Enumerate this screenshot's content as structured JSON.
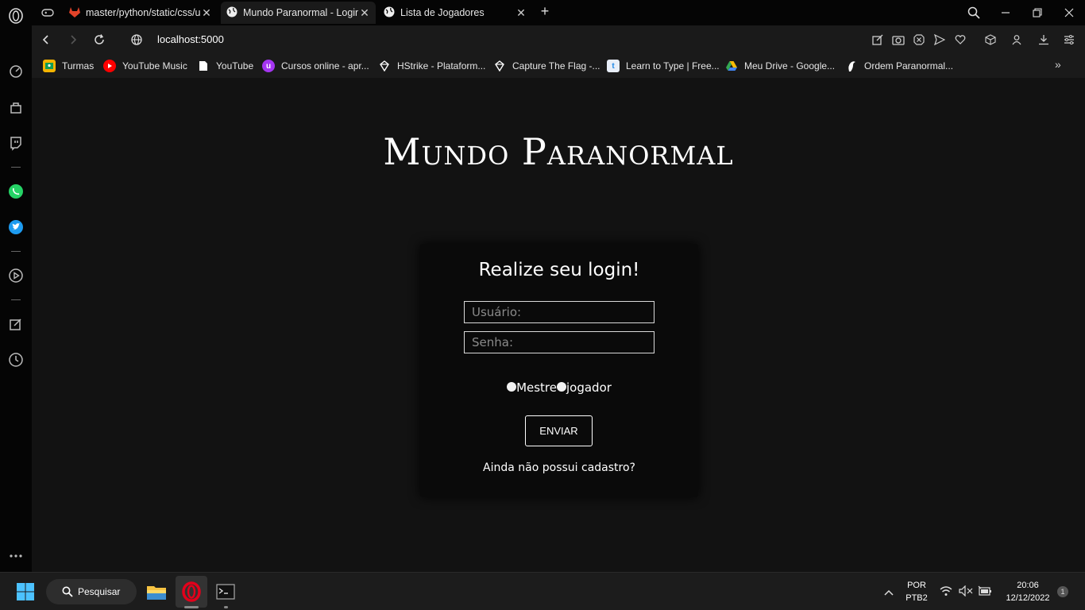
{
  "browser": {
    "tabs": [
      {
        "title": "master/python/static/css/u",
        "active": false
      },
      {
        "title": "Mundo Paranormal - Login",
        "active": true
      },
      {
        "title": "Lista de Jogadores",
        "active": false
      }
    ],
    "new_tab": "+",
    "address": "localhost:5000",
    "bookmarks": [
      {
        "label": "Turmas",
        "icon": "classroom-icon",
        "color": "#f4b400"
      },
      {
        "label": "YouTube Music",
        "icon": "youtube-music-icon",
        "color": "#ff0000"
      },
      {
        "label": "YouTube",
        "icon": "document-icon",
        "color": "#ffffff"
      },
      {
        "label": "Cursos online - apr...",
        "icon": "udemy-icon",
        "color": "#a435f0"
      },
      {
        "label": "HStrike - Plataform...",
        "icon": "hstrike-icon",
        "color": "#ffffff"
      },
      {
        "label": "Capture The Flag -...",
        "icon": "ctf-icon",
        "color": "#ffffff"
      },
      {
        "label": "Learn to Type | Free...",
        "icon": "typing-icon",
        "color": "#1e88e5"
      },
      {
        "label": "Meu Drive - Google...",
        "icon": "google-drive-icon",
        "color": "#34a853"
      },
      {
        "label": "Ordem Paranormal...",
        "icon": "ordem-icon",
        "color": "#ffffff"
      }
    ]
  },
  "page": {
    "brand": "Mundo Paranormal",
    "login": {
      "heading": "Realize seu login!",
      "username_placeholder": "Usuário:",
      "password_placeholder": "Senha:",
      "role_master": "Mestre",
      "role_player": "jogador",
      "submit_label": "ENVIAR",
      "register_link": "Ainda não possui cadastro?"
    }
  },
  "taskbar": {
    "search_label": "Pesquisar",
    "language": "POR",
    "keyboard": "PTB2",
    "time": "20:06",
    "date": "12/12/2022",
    "notifications": "1"
  }
}
